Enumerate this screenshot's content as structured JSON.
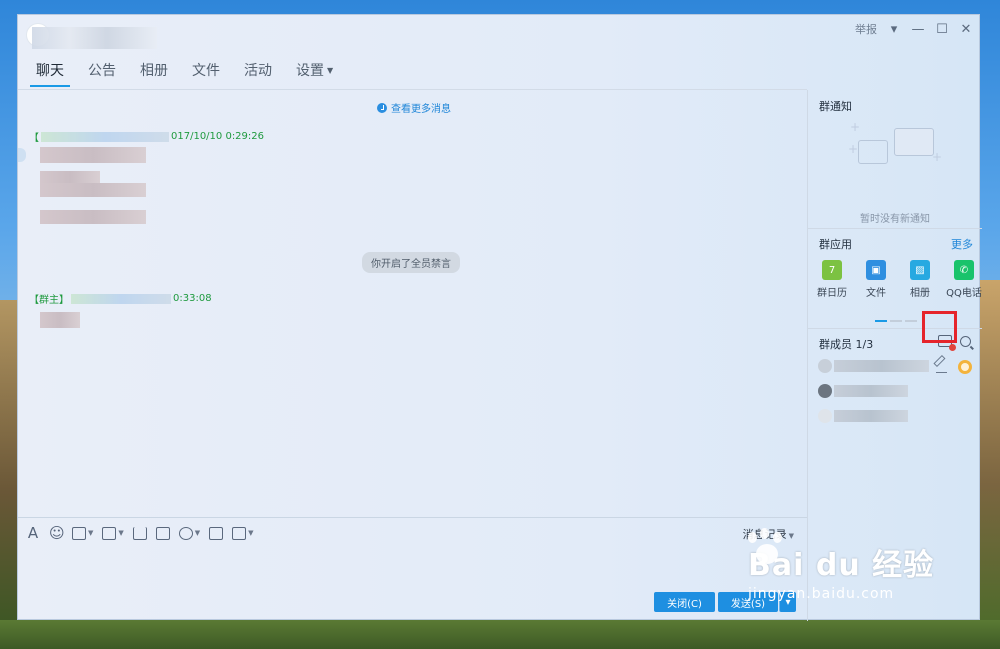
{
  "window": {
    "report_label": "举报",
    "controls": [
      "▾",
      "—",
      "☐",
      "✕"
    ]
  },
  "tabs": [
    {
      "label": "聊天",
      "active": true
    },
    {
      "label": "公告",
      "active": false
    },
    {
      "label": "相册",
      "active": false
    },
    {
      "label": "文件",
      "active": false
    },
    {
      "label": "活动",
      "active": false
    },
    {
      "label": "设置",
      "active": false,
      "dropdown": true
    }
  ],
  "chat": {
    "more_messages": "查看更多消息",
    "msg1": {
      "tag_open": "【",
      "timestamp": "017/10/10 0:29:26"
    },
    "notice": "你开启了全员禁言",
    "msg2": {
      "tag": "【群主】",
      "timestamp": "0:33:08"
    }
  },
  "toolbar": {
    "font_glyph": "A",
    "emoji_glyph": "☺",
    "history_label": "消息记录"
  },
  "buttons": {
    "close": "关闭(C)",
    "send": "发送(S)",
    "send_more": "▾"
  },
  "sidebar": {
    "notice_title": "群通知",
    "notice_empty": "暂时没有新通知",
    "apps_title": "群应用",
    "apps_more": "更多",
    "apps": [
      {
        "label": "群日历",
        "color": "#7cc242",
        "glyph": "7"
      },
      {
        "label": "文件",
        "color": "#2f8fe0",
        "glyph": "▣"
      },
      {
        "label": "相册",
        "color": "#27a9e1",
        "glyph": "▨"
      },
      {
        "label": "QQ电话",
        "color": "#19c36b",
        "glyph": "✆"
      }
    ],
    "members_title": "群成员 1/3"
  },
  "watermark": {
    "main": "Bai du 经验",
    "sub": "jingyan.baidu.com"
  }
}
